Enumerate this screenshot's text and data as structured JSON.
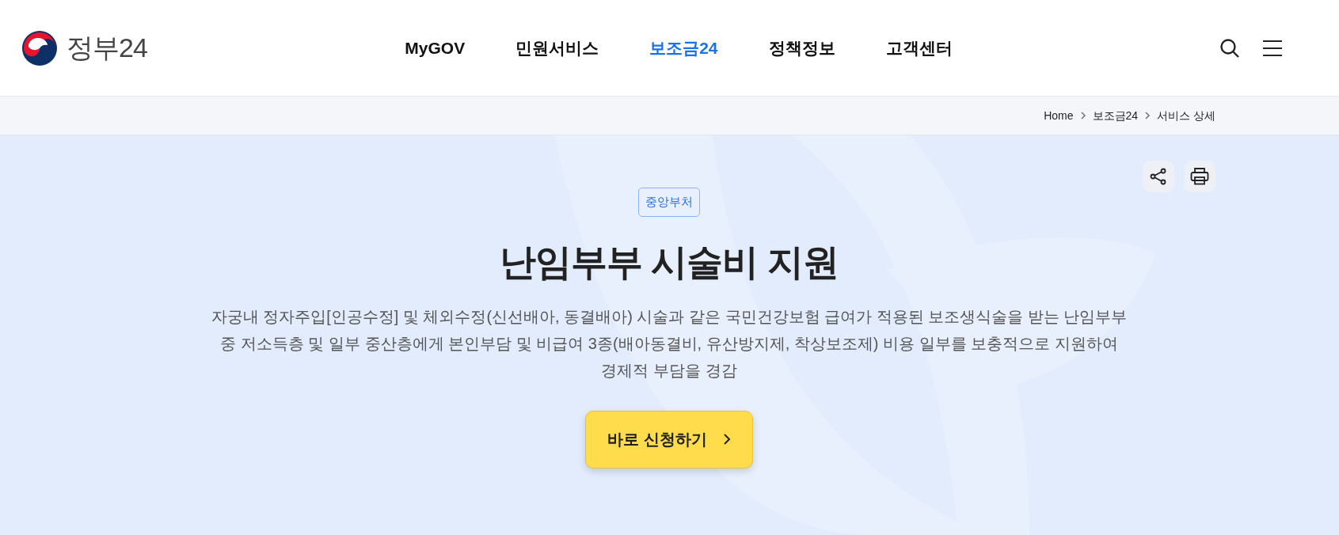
{
  "header": {
    "logo_text": "정부24",
    "nav": [
      {
        "label": "MyGOV",
        "selected": false
      },
      {
        "label": "민원서비스",
        "selected": false
      },
      {
        "label": "보조금24",
        "selected": true
      },
      {
        "label": "정책정보",
        "selected": false
      },
      {
        "label": "고객센터",
        "selected": false
      }
    ]
  },
  "breadcrumb": [
    "Home",
    "보조금24",
    "서비스 상세"
  ],
  "hero": {
    "badge": "중앙부처",
    "title": "난임부부 시술비 지원",
    "description": "자궁내 정자주입[인공수정] 및 체외수정(신선배아, 동결배아) 시술과 같은 국민건강보험 급여가 적용된 보조생식술을 받는 난임부부 중 저소득층 및 일부 중산층에게 본인부담 및 비급여 3종(배아동결비, 유산방지제, 착상보조제) 비용 일부를 보충적으로 지원하여 경제적 부담을 경감",
    "apply_button": "바로 신청하기"
  }
}
